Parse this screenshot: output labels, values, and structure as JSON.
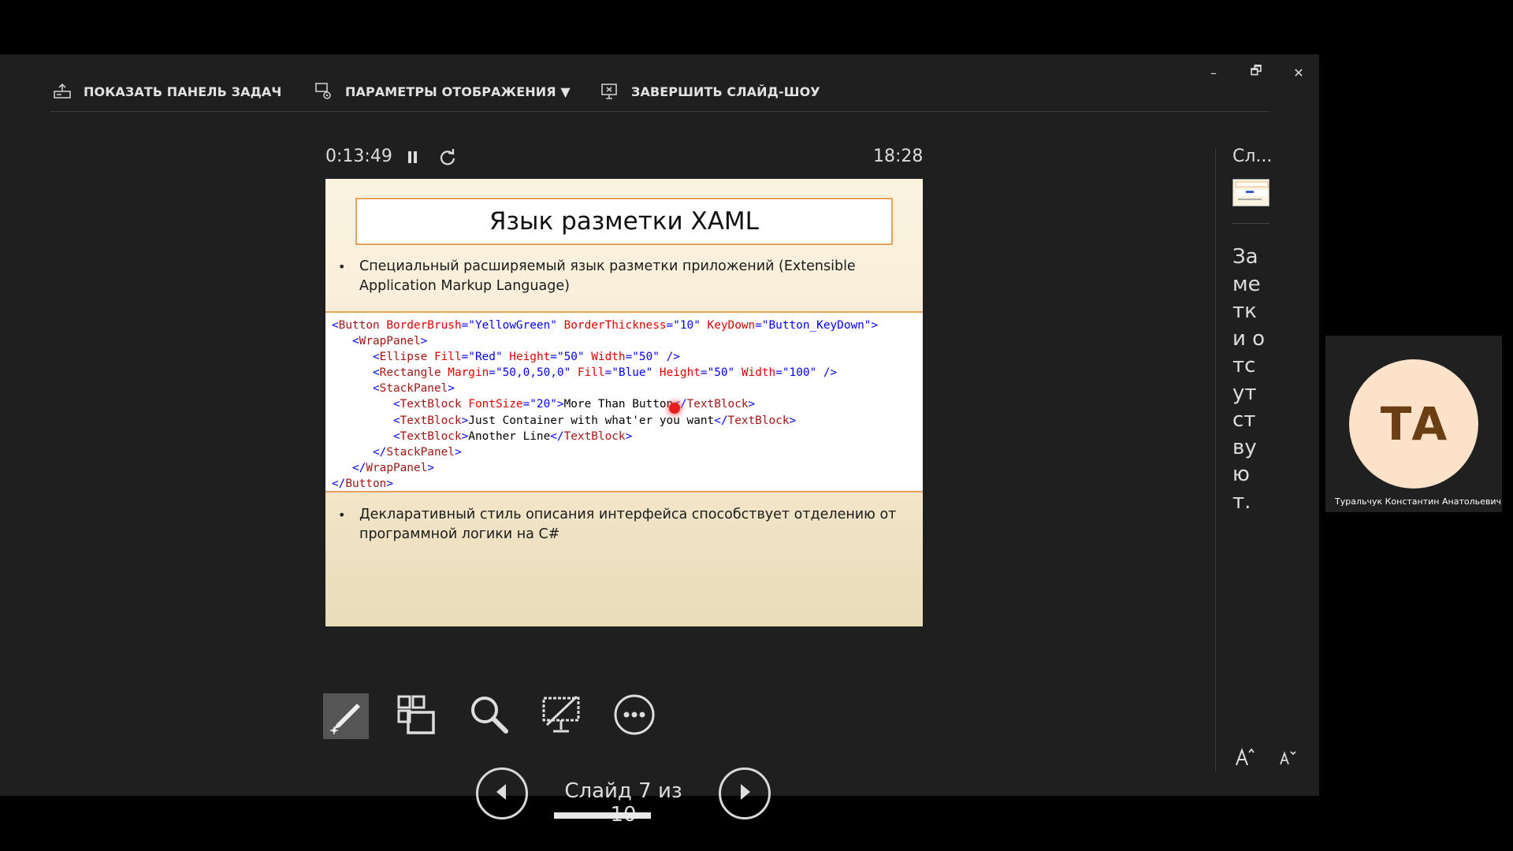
{
  "toolbar": {
    "show_taskbar": "ПОКАЗАТЬ ПАНЕЛЬ ЗАДАЧ",
    "display_settings": "ПАРАМЕТРЫ ОТОБРАЖЕНИЯ ▼",
    "end_show": "ЗАВЕРШИТЬ СЛАЙД-ШОУ"
  },
  "window": {
    "minimize": "–",
    "restore": "🗗",
    "close": "✕"
  },
  "timer": {
    "elapsed": "0:13:49",
    "clock": "18:28"
  },
  "slide": {
    "title": "Язык разметки XAML",
    "bullet1_a": "Специальный расширяемый язык разметки приложений (Extensible",
    "bullet1_b": "Application Markup Language)",
    "bullet2_a": "Декларативный стиль описания интерфейса способствует отделению от",
    "bullet2_b": "программной логики на C#",
    "bullet_symbol": "•",
    "code": [
      [
        [
          "br",
          "<"
        ],
        [
          "tg",
          "Button"
        ],
        [
          "at",
          " BorderBrush"
        ],
        [
          "br",
          "=\"YellowGreen\""
        ],
        [
          "at",
          " BorderThickness"
        ],
        [
          "br",
          "=\"10\""
        ],
        [
          "at",
          " KeyDown"
        ],
        [
          "br",
          "=\"Button_KeyDown\">"
        ]
      ],
      [
        [
          "br",
          "   <"
        ],
        [
          "tg",
          "WrapPanel"
        ],
        [
          "br",
          ">"
        ]
      ],
      [
        [
          "br",
          "      <"
        ],
        [
          "tg",
          "Ellipse"
        ],
        [
          "at",
          " Fill"
        ],
        [
          "br",
          "=\"Red\""
        ],
        [
          "at",
          " Height"
        ],
        [
          "br",
          "=\"50\""
        ],
        [
          "at",
          " Width"
        ],
        [
          "br",
          "=\"50\""
        ],
        [
          "br",
          " />"
        ]
      ],
      [
        [
          "br",
          "      <"
        ],
        [
          "tg",
          "Rectangle"
        ],
        [
          "at",
          " Margin"
        ],
        [
          "br",
          "=\"50,0,50,0\""
        ],
        [
          "at",
          " Fill"
        ],
        [
          "br",
          "=\"Blue\""
        ],
        [
          "at",
          " Height"
        ],
        [
          "br",
          "=\"50\""
        ],
        [
          "at",
          " Width"
        ],
        [
          "br",
          "=\"100\""
        ],
        [
          "br",
          " />"
        ]
      ],
      [
        [
          "br",
          "      <"
        ],
        [
          "tg",
          "StackPanel"
        ],
        [
          "br",
          ">"
        ]
      ],
      [
        [
          "br",
          "         <"
        ],
        [
          "tg",
          "TextBlock"
        ],
        [
          "at",
          " FontSize"
        ],
        [
          "br",
          "=\"20\">"
        ],
        [
          "tx",
          "More Than Button"
        ],
        [
          "br",
          "</"
        ],
        [
          "tg",
          "TextBlock"
        ],
        [
          "br",
          ">"
        ]
      ],
      [
        [
          "br",
          "         <"
        ],
        [
          "tg",
          "TextBlock"
        ],
        [
          "br",
          ">"
        ],
        [
          "tx",
          "Just Container with what'er you want"
        ],
        [
          "br",
          "</"
        ],
        [
          "tg",
          "TextBlock"
        ],
        [
          "br",
          ">"
        ]
      ],
      [
        [
          "br",
          "         <"
        ],
        [
          "tg",
          "TextBlock"
        ],
        [
          "br",
          ">"
        ],
        [
          "tx",
          "Another Line"
        ],
        [
          "br",
          "</"
        ],
        [
          "tg",
          "TextBlock"
        ],
        [
          "br",
          ">"
        ]
      ],
      [
        [
          "br",
          "      </"
        ],
        [
          "tg",
          "StackPanel"
        ],
        [
          "br",
          ">"
        ]
      ],
      [
        [
          "br",
          "   </"
        ],
        [
          "tg",
          "WrapPanel"
        ],
        [
          "br",
          ">"
        ]
      ],
      [
        [
          "br",
          "</"
        ],
        [
          "tg",
          "Button"
        ],
        [
          "br",
          ">"
        ]
      ]
    ]
  },
  "navigation": {
    "counter": "Слайд 7 из 10",
    "progress_fraction": 0.7
  },
  "next_slide": {
    "label": "Сл..."
  },
  "notes": {
    "text": "Заметки отсутствуют."
  },
  "participant": {
    "initials": "ТА",
    "name": "Туральчук Константин Анатольевич"
  },
  "icons": [
    "taskbar-icon",
    "display-settings-icon",
    "end-show-icon",
    "pause-icon",
    "restart-icon",
    "pen-icon",
    "slides-grid-icon",
    "zoom-icon",
    "screen-toggle-icon",
    "more-icon",
    "prev-icon",
    "next-icon"
  ]
}
